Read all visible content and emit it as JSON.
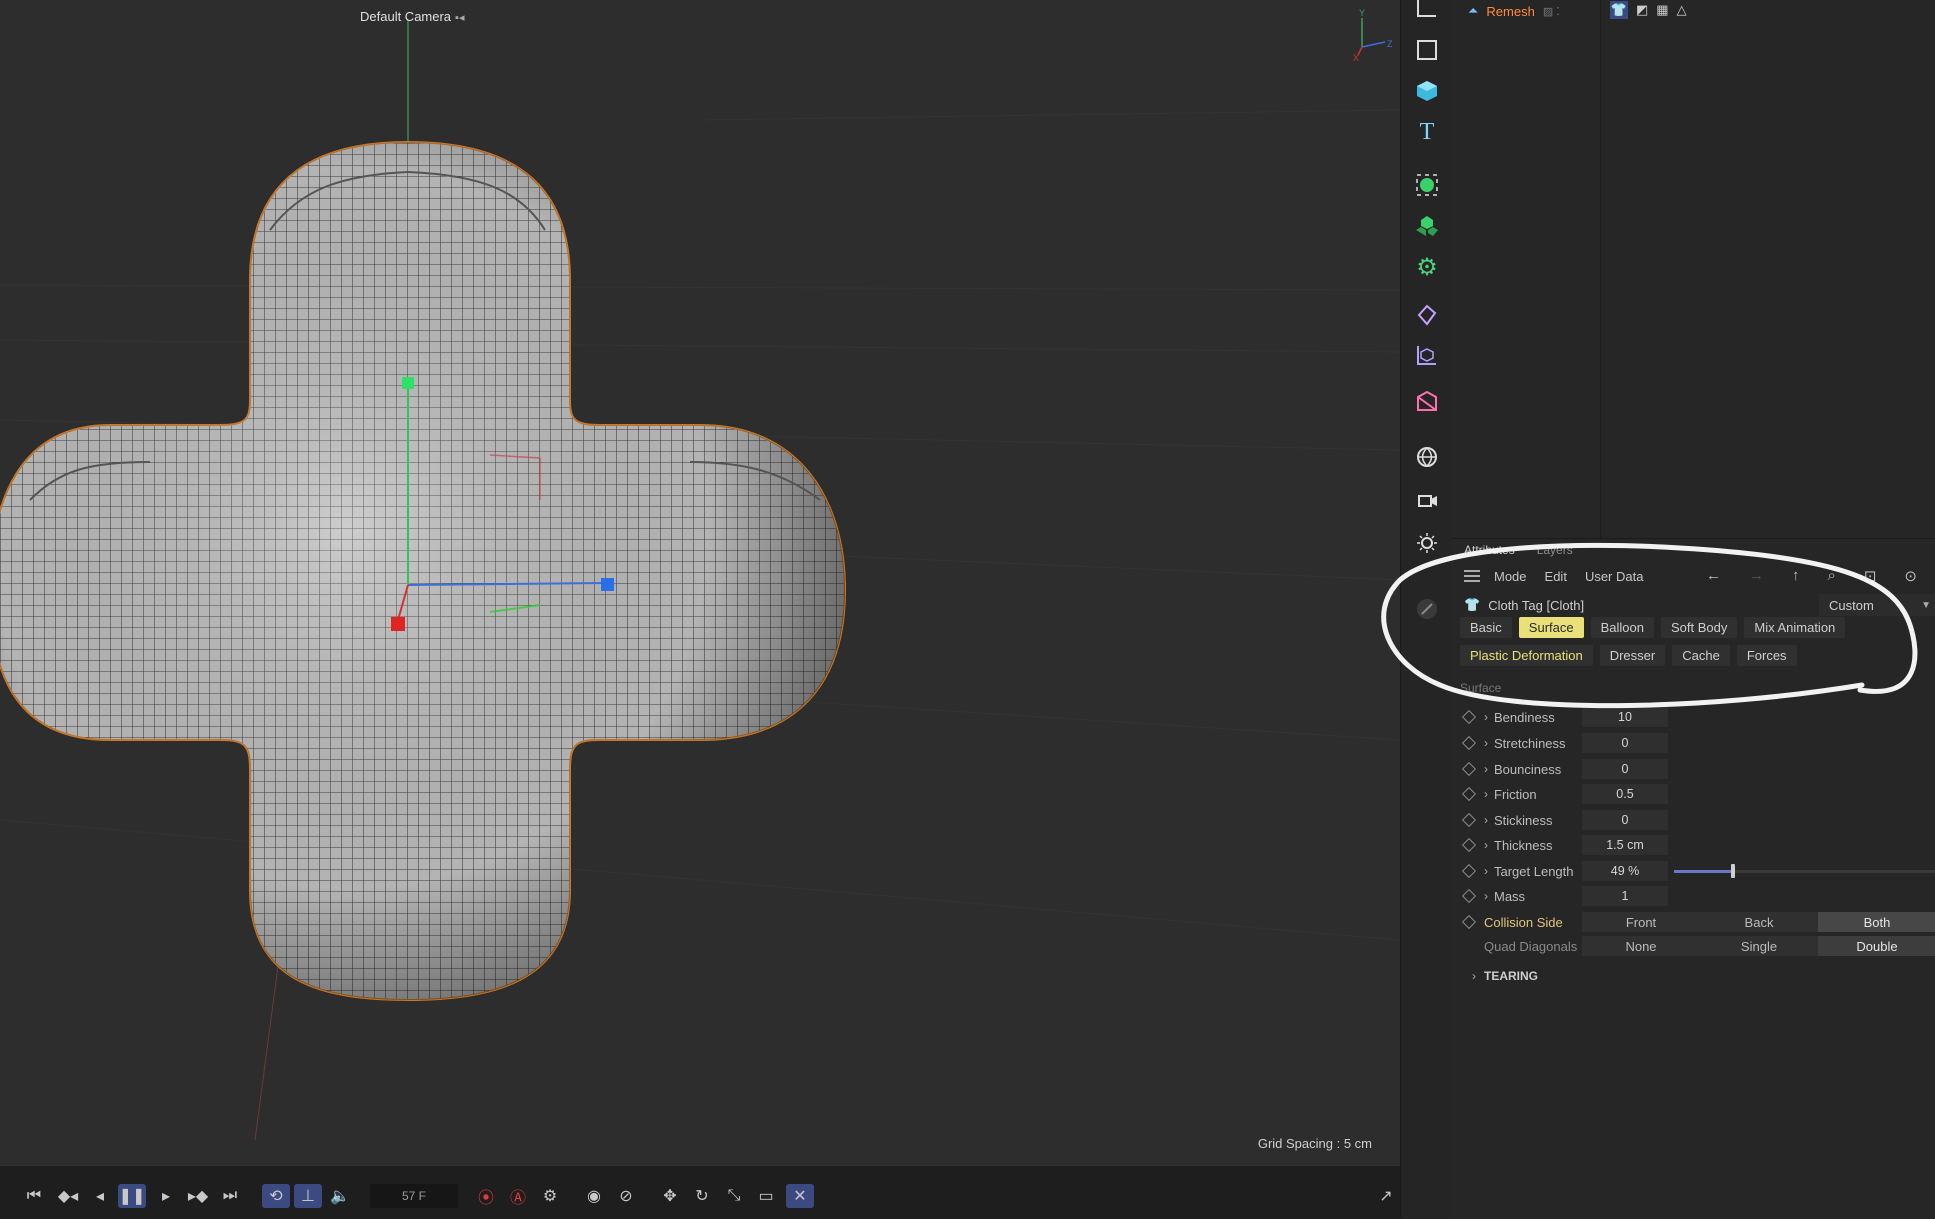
{
  "viewport": {
    "camera_label": "Default Camera",
    "grid_spacing": "Grid Spacing : 5 cm",
    "axis_labels": [
      "Y",
      "Z",
      "X"
    ]
  },
  "timeline": {
    "current_frame": "57 F"
  },
  "object_manager": {
    "object_name": "Remesh"
  },
  "attributes": {
    "tabs": [
      "Attributes",
      "Layers"
    ],
    "menu": [
      "Mode",
      "Edit",
      "User Data"
    ],
    "object_title": "Cloth Tag [Cloth]",
    "preset": "Custom",
    "page_tabs_row1": [
      "Basic",
      "Surface",
      "Balloon",
      "Soft Body",
      "Mix Animation"
    ],
    "page_tabs_row2": [
      "Plastic Deformation",
      "Dresser",
      "Cache",
      "Forces"
    ],
    "active_tab": "Surface",
    "section": "Surface",
    "properties": [
      {
        "name": "Bendiness",
        "value": "10"
      },
      {
        "name": "Stretchiness",
        "value": "0"
      },
      {
        "name": "Bounciness",
        "value": "0"
      },
      {
        "name": "Friction",
        "value": "0.5"
      },
      {
        "name": "Stickiness",
        "value": "0"
      },
      {
        "name": "Thickness",
        "value": "1.5 cm"
      },
      {
        "name": "Target Length",
        "value": "49 %",
        "slider_fraction": 0.49
      },
      {
        "name": "Mass",
        "value": "1"
      }
    ],
    "collision_side": {
      "label": "Collision Side",
      "options": [
        "Front",
        "Back",
        "Both"
      ],
      "selected": "Both"
    },
    "quad_diagonals": {
      "label": "Quad Diagonals",
      "options": [
        "None",
        "Single",
        "Double"
      ],
      "selected": "Double"
    },
    "tearing": "TEARING"
  },
  "colors": {
    "active_tab": "#e9e07a",
    "selection_outline": "#c7782c",
    "highlight_circle": "#f2f2f2",
    "slider_fill": "#6a77c9"
  }
}
